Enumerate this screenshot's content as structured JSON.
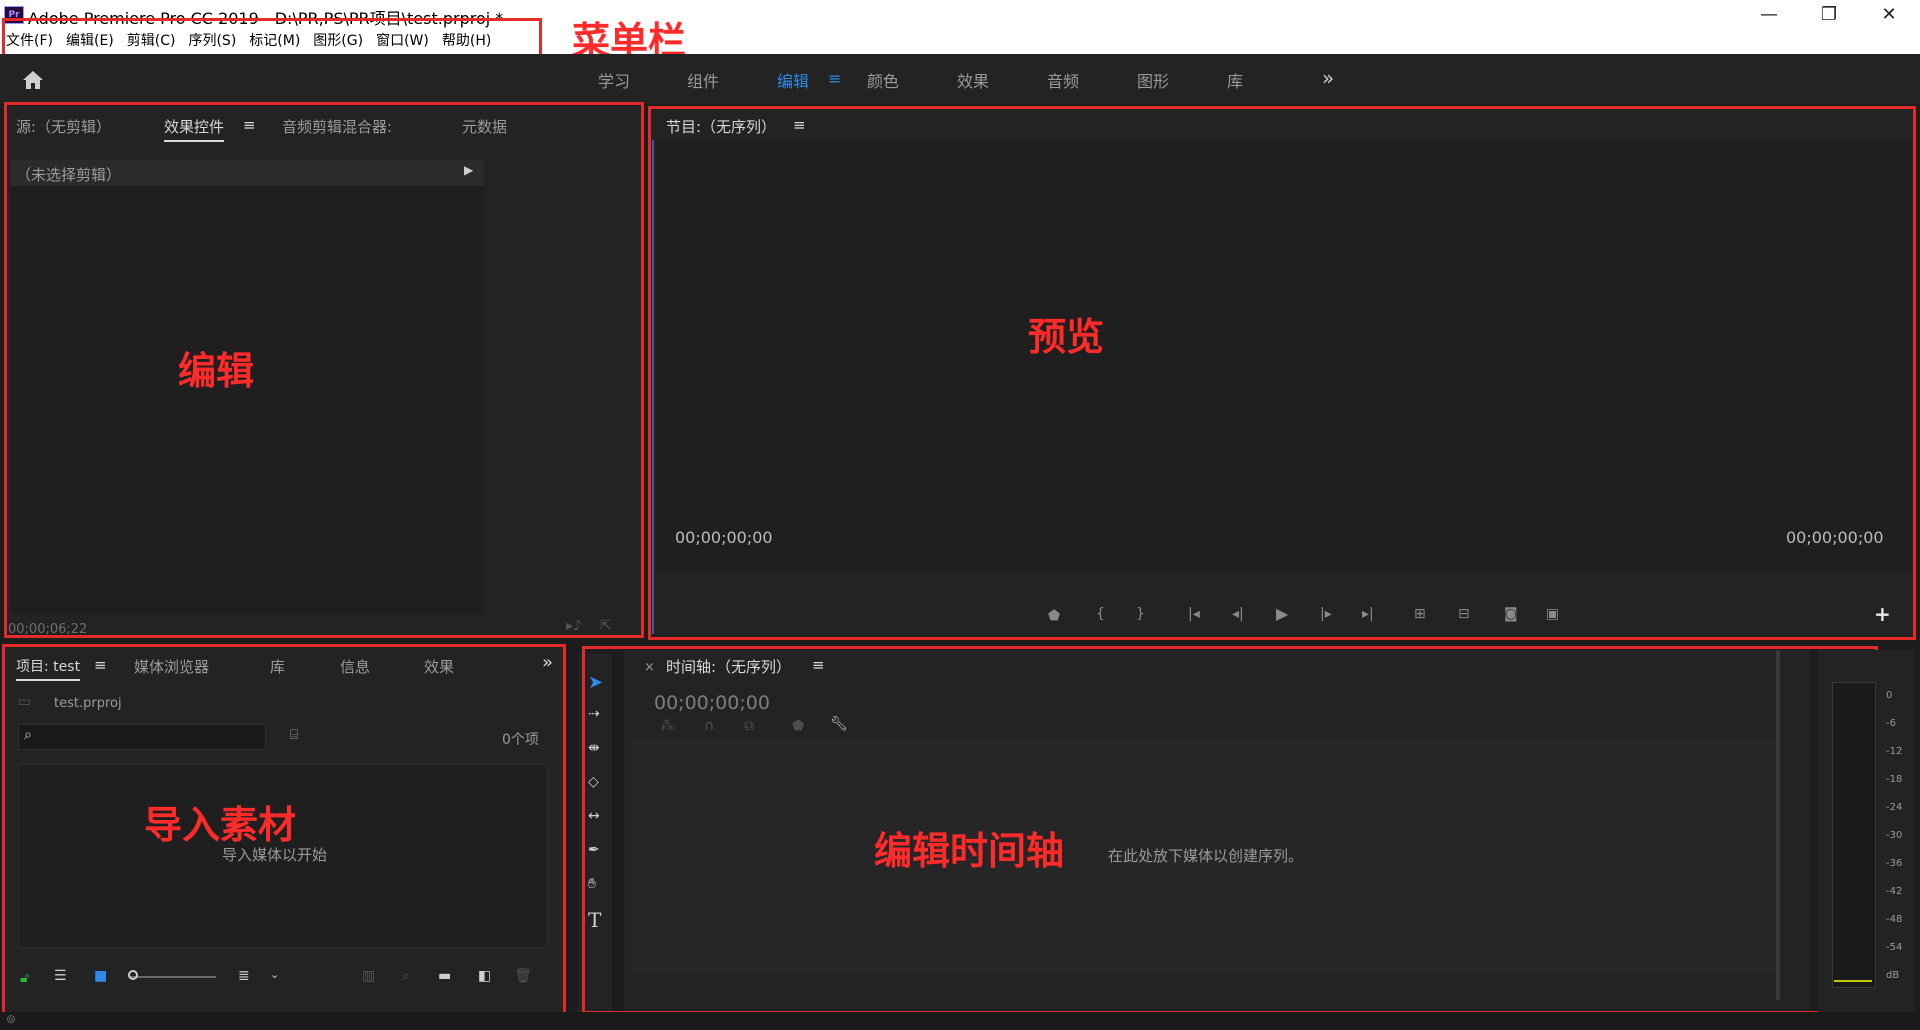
{
  "window": {
    "title": "Adobe Premiere Pro CC 2019 - D:\\PR,PS\\PR项目\\test.prproj *",
    "logo": "Pr",
    "controls": [
      "—",
      "❐",
      "✕"
    ]
  },
  "menu": [
    "文件(F)",
    "编辑(E)",
    "剪辑(C)",
    "序列(S)",
    "标记(M)",
    "图形(G)",
    "窗口(W)",
    "帮助(H)"
  ],
  "workspaces": [
    {
      "label": "学习",
      "active": false
    },
    {
      "label": "组件",
      "active": false
    },
    {
      "label": "编辑",
      "active": true
    },
    {
      "label": "颜色",
      "active": false
    },
    {
      "label": "效果",
      "active": false
    },
    {
      "label": "音频",
      "active": false
    },
    {
      "label": "图形",
      "active": false
    },
    {
      "label": "库",
      "active": false
    }
  ],
  "workspace_more": "»",
  "source_panel": {
    "tabs": [
      "源:（无剪辑）",
      "效果控件",
      "音频剪辑混合器:",
      "元数据"
    ],
    "active_tab": 1,
    "no_clip": "（未选择剪辑）",
    "timecode": "00;00;06;22"
  },
  "program_panel": {
    "title": "节目:（无序列）",
    "timecode_left": "00;00;00;00",
    "timecode_right": "00;00;00;00"
  },
  "project_panel": {
    "tabs": [
      "项目: test",
      "媒体浏览器",
      "库",
      "信息",
      "效果"
    ],
    "active_tab": 0,
    "file": "test.prproj",
    "search_placeholder": "",
    "item_count": "0个项",
    "empty_hint": "导入媒体以开始"
  },
  "timeline_panel": {
    "title": "时间轴:（无序列）",
    "timecode": "00;00;00;00",
    "drop_hint": "在此处放下媒体以创建序列。"
  },
  "meter_scale": [
    "0",
    "-6",
    "-12",
    "-18",
    "-24",
    "-30",
    "-36",
    "-42",
    "-48",
    "-54",
    "dB"
  ],
  "annotations": {
    "menu": "菜单栏",
    "edit": "编辑",
    "preview": "预览",
    "import": "导入素材",
    "timeline": "编辑时间轴"
  },
  "colors": {
    "annotation": "#ff2a2a",
    "accent": "#2d8ceb",
    "panel": "#232323",
    "background": "#1d1d1d"
  }
}
